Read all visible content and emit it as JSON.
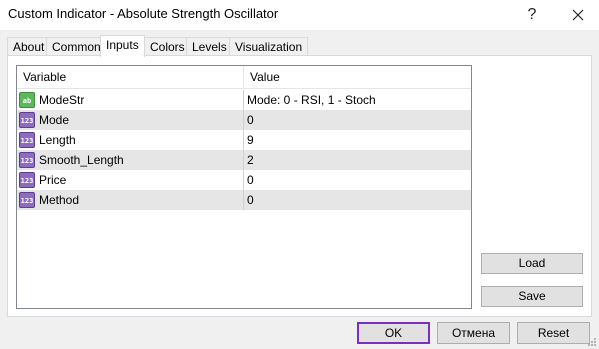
{
  "window": {
    "title": "Custom Indicator - Absolute Strength Oscillator",
    "help_glyph": "?",
    "close_glyph": "✕"
  },
  "tabs": [
    {
      "label": "About"
    },
    {
      "label": "Common"
    },
    {
      "label": "Inputs",
      "active": true
    },
    {
      "label": "Colors"
    },
    {
      "label": "Levels"
    },
    {
      "label": "Visualization"
    }
  ],
  "grid": {
    "col_variable": "Variable",
    "col_value": "Value",
    "rows": [
      {
        "icon": "string-icon",
        "icon_text": "ab",
        "variable": "ModeStr",
        "value": "Mode: 0 - RSI, 1 - Stoch"
      },
      {
        "icon": "number-icon",
        "icon_text": "123",
        "variable": "Mode",
        "value": "0"
      },
      {
        "icon": "number-icon",
        "icon_text": "123",
        "variable": "Length",
        "value": "9"
      },
      {
        "icon": "number-icon",
        "icon_text": "123",
        "variable": "Smooth_Length",
        "value": "2"
      },
      {
        "icon": "number-icon",
        "icon_text": "123",
        "variable": "Price",
        "value": "0"
      },
      {
        "icon": "number-icon",
        "icon_text": "123",
        "variable": "Method",
        "value": "0"
      }
    ]
  },
  "side_buttons": {
    "load": "Load",
    "save": "Save"
  },
  "footer": {
    "ok": "OK",
    "cancel": "Отмена",
    "reset": "Reset"
  },
  "colors": {
    "ok_border": "#7b2fbf",
    "alt_row": "#e6e6e6"
  }
}
